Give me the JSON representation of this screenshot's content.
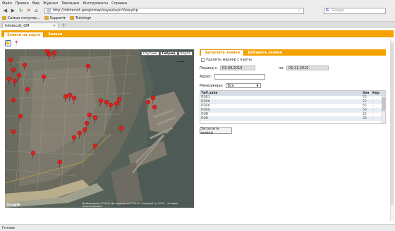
{
  "browser": {
    "menu": [
      "Файл",
      "Правка",
      "Вид",
      "Журнал",
      "Закладки",
      "Инструменты",
      "Справка"
    ],
    "url": "http://infotecstt-googlemap/zayavka/scView.php",
    "search_placeholder": "Google",
    "search_engine": "G",
    "bookmarks": [
      "Самые популяр...",
      "Support",
      "Training"
    ],
    "tab_title": "Infotecstt_GM",
    "status": "Готово"
  },
  "app": {
    "tabs": [
      "Заявки на карте",
      "Заявки"
    ],
    "map_types": [
      "Спутник",
      "Гибрид",
      "Карта"
    ],
    "map_logo": "Google",
    "map_copyright": "Изображения ©2010, Данные карты ©2010, Copyright (c) 2009, · Условия использования",
    "panel_tabs": [
      "Загрузить заявки",
      "Добавить заявки"
    ],
    "remove_marker_label": "Удалить маркер с карты",
    "period_label": "Период с:",
    "date_from": "03.09.2010",
    "to_label": "по:",
    "date_to": "03.11.2010",
    "address_label": "Адрес:",
    "managers_label": "Менеджеры:",
    "managers_value": "Все",
    "table": {
      "headers": [
        "Тип",
        "Т.заяв",
        "",
        "Зон",
        "Кор"
      ],
      "rows": [
        [
          "ПЕР",
          "11",
          "",
          "75",
          "-"
        ],
        [
          "ПЕР",
          "16",
          "",
          "72",
          "-"
        ],
        [
          "ПЕР",
          "16",
          "",
          "55",
          "-"
        ],
        [
          "ПЕР",
          "10",
          "",
          "50",
          "-"
        ],
        [
          "ПЕР",
          "0",
          "",
          "25",
          "-"
        ],
        [
          "ПЕР",
          "2",
          "",
          "36",
          "-"
        ]
      ]
    },
    "load_button": "Загрузить заявки"
  },
  "colors": {
    "accent": "#f5a300",
    "marker": "#e0201c"
  }
}
